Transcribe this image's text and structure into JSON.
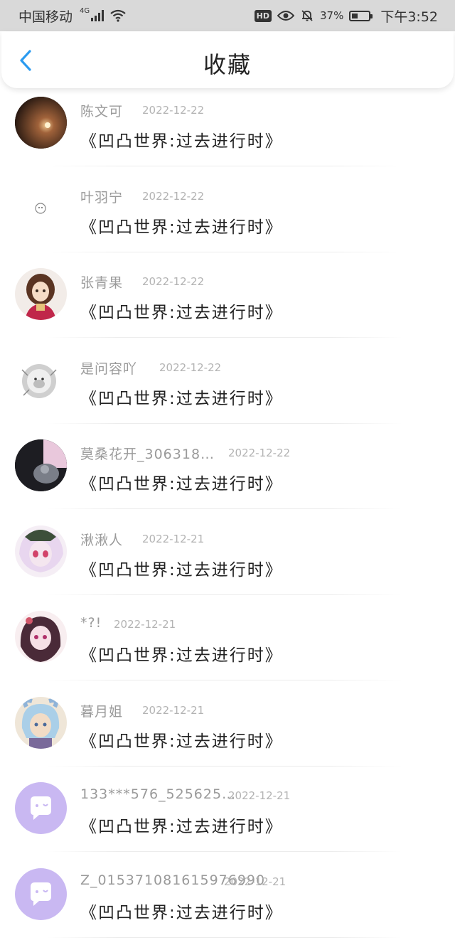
{
  "status_bar": {
    "carrier": "中国移动",
    "network": "4G",
    "battery_pct": "37%",
    "battery_level": 0.37,
    "time": "下午3:52",
    "icons": [
      "signal-icon",
      "wifi-icon",
      "hd-icon",
      "eye-icon",
      "mute-bell-icon",
      "battery-icon"
    ]
  },
  "header": {
    "title": "收藏",
    "back_icon": "chevron-left-icon",
    "accent": "#2b9bf0"
  },
  "favorites": [
    {
      "name": "陈文可",
      "date": "2022-12-22",
      "content": "《凹凸世界:过去进行时》",
      "avatar": "photo-sunset"
    },
    {
      "name": "叶羽宁",
      "date": "2022-12-22",
      "content": "《凹凸世界:过去进行时》",
      "avatar": "small-doodle"
    },
    {
      "name": "张青果",
      "date": "2022-12-22",
      "content": "《凹凸世界:过去进行时》",
      "avatar": "anime-girl-brown-hair"
    },
    {
      "name": "是问容吖",
      "date": "2022-12-22",
      "content": "《凹凸世界:过去进行时》",
      "avatar": "lion-sketch"
    },
    {
      "name": "莫桑花开_306318…",
      "date": "2022-12-22",
      "content": "《凹凸世界:过去进行时》",
      "avatar": "dark-photo-cat"
    },
    {
      "name": "湫湫人",
      "date": "2022-12-21",
      "content": "《凹凸世界:过去进行时》",
      "avatar": "anime-white-hair"
    },
    {
      "name": "*?!",
      "date": "2022-12-21",
      "content": "《凹凸世界:过去进行时》",
      "avatar": "anime-dark-hair-girl"
    },
    {
      "name": "暮月姐",
      "date": "2022-12-21",
      "content": "《凹凸世界:过去进行时》",
      "avatar": "anime-blue-hair"
    },
    {
      "name": "133***576_525625…",
      "date": "2022-12-21",
      "content": "《凹凸世界:过去进行时》",
      "avatar": "default-chat-bubble"
    },
    {
      "name": "Z_015371081615976990",
      "date": "2022-12-21",
      "content": "《凹凸世界:过去进行时》",
      "avatar": "default-chat-bubble"
    }
  ],
  "colors": {
    "status_bar_bg": "#d9d9d9",
    "name_color": "#9a9a9a",
    "date_color": "#b3b3b3",
    "default_avatar": "#c9b8f2"
  }
}
